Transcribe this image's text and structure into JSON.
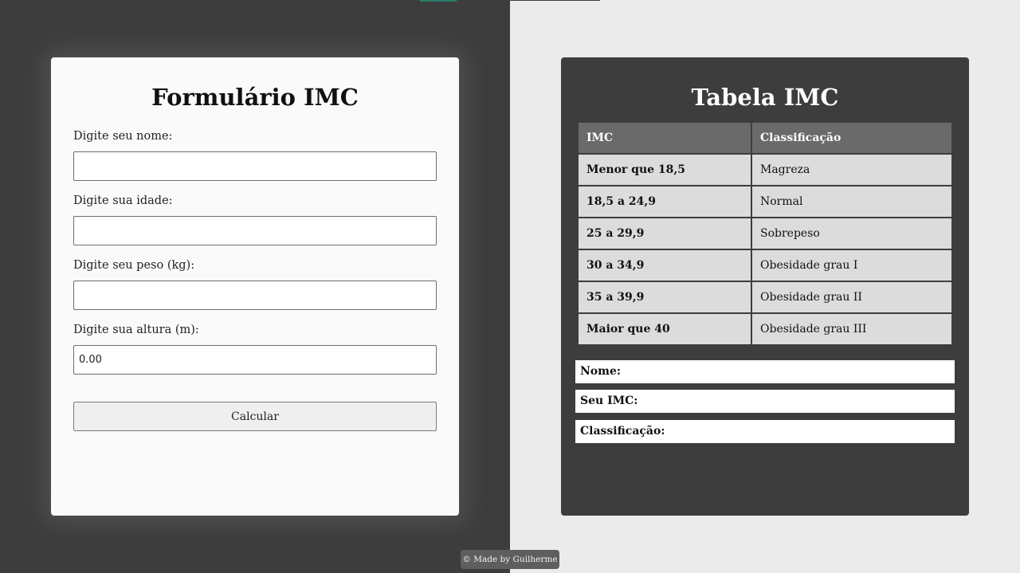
{
  "form": {
    "title": "Formulário IMC",
    "fields": [
      {
        "label": "Digite seu nome:",
        "value": ""
      },
      {
        "label": "Digite sua idade:",
        "value": ""
      },
      {
        "label": "Digite seu peso (kg):",
        "value": ""
      },
      {
        "label": "Digite sua altura (m):",
        "value": "0.00"
      }
    ],
    "button_label": "Calcular"
  },
  "table": {
    "title": "Tabela IMC",
    "headers": [
      "IMC",
      "Classificação"
    ],
    "rows": [
      {
        "range": "Menor que 18,5",
        "classification": "Magreza"
      },
      {
        "range": "18,5 a 24,9",
        "classification": "Normal"
      },
      {
        "range": "25 a 29,9",
        "classification": "Sobrepeso"
      },
      {
        "range": "30 a 34,9",
        "classification": "Obesidade grau I"
      },
      {
        "range": "35 a 39,9",
        "classification": "Obesidade grau II"
      },
      {
        "range": "Maior que 40",
        "classification": "Obesidade grau III"
      }
    ]
  },
  "results": {
    "name_label": "Nome:",
    "imc_label": "Seu IMC:",
    "classification_label": "Classificação:"
  },
  "footer": {
    "text": "© Made by Guilherme"
  },
  "colors": {
    "dark_bg": "#3d3d3d",
    "light_bg": "#ebebeb",
    "card_bg": "#fafafa",
    "table_header": "#6a6a6a",
    "table_cell": "#dcdcdc"
  }
}
